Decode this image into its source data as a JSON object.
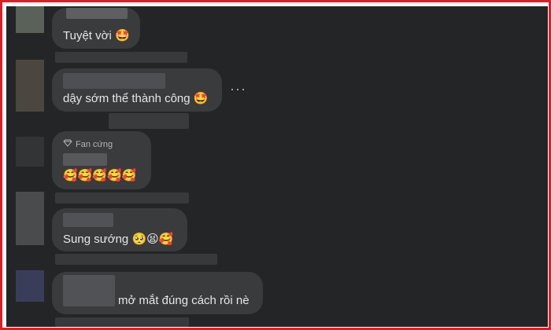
{
  "comments": [
    {
      "text": "Tuyệt vời",
      "emoji": "🤩"
    },
    {
      "text": "dậy sớm thể thành công",
      "emoji": "🤩"
    },
    {
      "badge_icon": "diamond-icon",
      "badge": "Fan cứng",
      "text": "",
      "emoji": "🥰🥰🥰🥰🥰"
    },
    {
      "text": "Sung sướng",
      "emoji": "🥺😫🥰"
    },
    {
      "text": "mở mắt đúng cách rồi nè",
      "emoji": ""
    }
  ],
  "more_button": "···",
  "colors": {
    "frame_border": "#e41b23",
    "background": "#242526",
    "bubble": "#3a3b3c",
    "text": "#e4e6eb"
  }
}
